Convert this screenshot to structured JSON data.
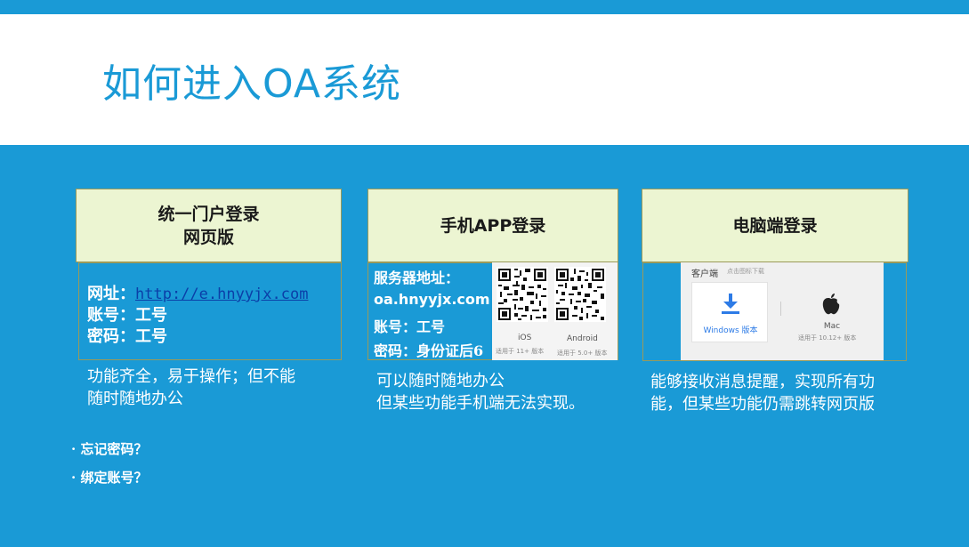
{
  "title": "如何进入OA系统",
  "portal": {
    "heading_line1": "统一门户登录",
    "heading_line2": "网页版",
    "url_label": "网址：",
    "url": "http://e.hnyyjx.com",
    "account": "账号：工号",
    "password": "密码：工号",
    "desc_line1": "功能齐全，易于操作；但不能",
    "desc_line2": "随时随地办公"
  },
  "mobile": {
    "heading": "手机APP登录",
    "server_label": "服务器地址：",
    "server": "oa.hnyyjx.com",
    "account": "账号：工号",
    "password": "密码：身份证后6",
    "ios_label": "iOS",
    "ios_sub": "适用于 11+ 版本",
    "android_label": "Android",
    "android_sub": "适用于 5.0+ 版本",
    "desc_line1": "可以随时随地办公",
    "desc_line2": "但某些功能手机端无法实现。"
  },
  "desktop": {
    "heading": "电脑端登录",
    "client_title": "客户端",
    "client_hint": "点击图标下载",
    "windows_label": "Windows 版本",
    "mac_label": "Mac",
    "mac_sub": "适用于 10.12+ 版本",
    "desc_line1": "能够接收消息提醒，实现所有功",
    "desc_line2": "能，但某些功能仍需跳转网页版"
  },
  "bullets": [
    "·  忘记密码？",
    "·  绑定账号？"
  ],
  "colors": {
    "background": "#1a9ad6",
    "header": "#ffffff",
    "card_head": "#ecf5d2",
    "title": "#1a9ad6"
  }
}
